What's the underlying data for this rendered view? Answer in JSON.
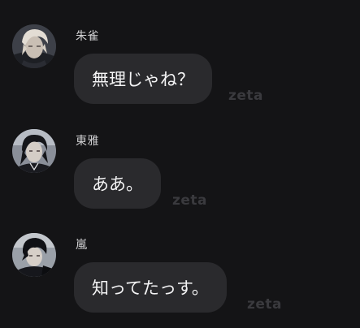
{
  "messages": [
    {
      "sender": "朱雀",
      "text": "無理じゃね？",
      "watermark": "zeta",
      "avatar_icon": "character-avatar-suzaku-icon"
    },
    {
      "sender": "東雅",
      "text": "ああ。",
      "watermark": "zeta",
      "avatar_icon": "character-avatar-touga-icon"
    },
    {
      "sender": "嵐",
      "text": "知ってたっす。",
      "watermark": "zeta",
      "avatar_icon": "character-avatar-arashi-icon"
    }
  ],
  "colors": {
    "background": "#141416",
    "bubble": "#2a2a2d",
    "name_text": "#d2d2d4",
    "message_text": "#f4f4f5",
    "watermark": "#3a3a3e"
  }
}
